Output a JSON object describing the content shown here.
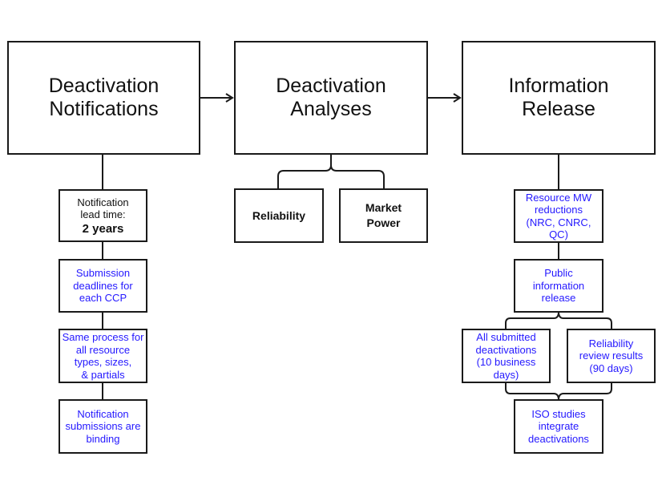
{
  "stages": [
    {
      "title": "Deactivation\nNotifications"
    },
    {
      "title": "Deactivation\nAnalyses"
    },
    {
      "title": "Information\nRelease"
    }
  ],
  "notifications": {
    "lead_time_label": "Notification\nlead time:",
    "lead_time_value": "2 years",
    "items": [
      "Submission\ndeadlines for\neach CCP",
      "Same process for\nall resource\ntypes, sizes,\n& partials",
      "Notification\nsubmissions are\nbinding"
    ]
  },
  "analyses": {
    "items": [
      "Reliability",
      "Market\nPower"
    ]
  },
  "release": {
    "items": [
      "Resource MW\nreductions\n(NRC, CNRC,\nQC)",
      "Public\ninformation\nrelease",
      "All submitted\ndeactivations\n(10 business\ndays)",
      "Reliability\nreview results\n(90 days)",
      "ISO studies\nintegrate\ndeactivations"
    ]
  },
  "colors": {
    "highlight_text": "#2418ff",
    "line": "#1a1a1a"
  }
}
